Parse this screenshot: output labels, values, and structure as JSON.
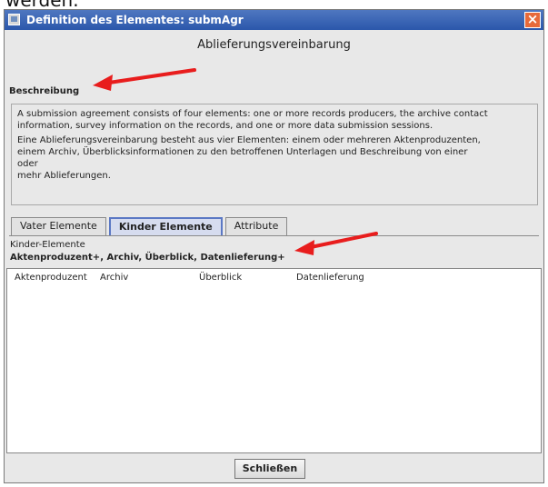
{
  "caption": {
    "text": "werden."
  },
  "window": {
    "title": "Definition des Elementes: submAgr",
    "heading": "Ablieferungsvereinbarung",
    "close_glyph": "×"
  },
  "description": {
    "label": "Beschreibung",
    "english": "A submission agreement consists of four elements: one or more records producers, the archive contact information, survey information on the records, and one or more data submission sessions.",
    "german_lines": [
      "Eine Ablieferungsvereinbarung besteht aus vier Elementen: einem oder mehreren Aktenproduzenten,",
      "einem Archiv, Überblicksinformationen zu den betroffenen Unterlagen und Beschreibung von einer",
      "oder",
      "mehr Ablieferungen."
    ]
  },
  "tabs": [
    {
      "label": "Vater Elemente"
    },
    {
      "label": "Kinder Elemente"
    },
    {
      "label": "Attribute"
    }
  ],
  "children": {
    "header": "Kinder-Elemente",
    "summary": "Aktenproduzent+, Archiv, Überblick, Datenlieferung+",
    "columns": [
      "Aktenproduzent",
      "Archiv",
      "Überblick",
      "Datenlieferung"
    ]
  },
  "footer": {
    "close_label": "Schließen"
  },
  "colors": {
    "arrow": "#e81d1d",
    "titlebar": "#2b57ab"
  }
}
